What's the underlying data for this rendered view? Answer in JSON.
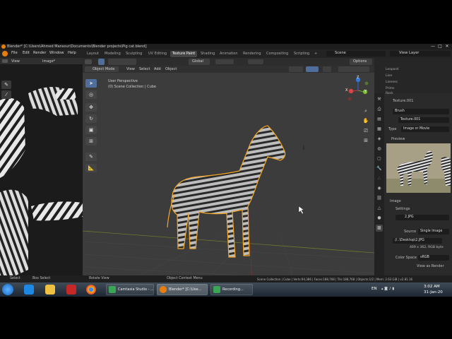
{
  "window": {
    "title": "Blender* [C:\\Users\\Ahmed Mansour\\Documents\\Blender projects\\Pig cat.blend]",
    "min": "—",
    "max": "□",
    "close": "✕"
  },
  "menu": [
    "File",
    "Edit",
    "Render",
    "Window",
    "Help"
  ],
  "workspaces": [
    "Layout",
    "Modeling",
    "Sculpting",
    "UV Editing",
    "Texture Paint",
    "Shading",
    "Animation",
    "Rendering",
    "Compositing",
    "Scripting"
  ],
  "active_workspace": "Texture Paint",
  "scene": {
    "label": "Scene",
    "view_layer": "View Layer"
  },
  "left_editor": {
    "view": "View",
    "image": "Image*"
  },
  "viewport": {
    "mode": "Object Mode",
    "menus": [
      "View",
      "Select",
      "Add",
      "Object"
    ],
    "orientation": "Global",
    "options": "Options",
    "perspective": "User Perspective",
    "collection": "(0) Scene Collection | Cube",
    "gizmo_axes": {
      "x": "X",
      "y": "Y",
      "z": "Z"
    }
  },
  "outliner": [
    "Leopard",
    "Lion",
    "Lioness",
    "Prims",
    "Rock"
  ],
  "properties": {
    "texture_name": "Texture.001",
    "context": "Brush",
    "texture_field": "Texture.001",
    "type_label": "Type",
    "type_value": "Image or Movie",
    "preview_label": "Preview",
    "image_label": "Image",
    "settings_label": "Settings",
    "image_file": "2.JPG",
    "source_label": "Source",
    "source_value": "Single Image",
    "filepath": "//..\\Desktop\\2.JPG",
    "info": "469 x 362,  RGB byte",
    "color_space_label": "Color Space",
    "color_space_value": "sRGB",
    "view_as_render": "View as Render"
  },
  "statusbar": {
    "select": "Select",
    "box_select": "Box Select",
    "rotate_view": "Rotate View",
    "context_menu": "Object Context Menu",
    "stats": "Scene Collection | Cube | Verts:94,386 | Faces:188,768 | Tris:188,768 | Objects:1/2 | Mem: 2.63 GiB | v2.81.16"
  },
  "taskbar": {
    "camtasia": "Camtasia Studio - ...",
    "blender": "Blender* [C:\\Use...",
    "recording": "Recording...",
    "lang": "EN",
    "time": "3:02 AM",
    "date": "31-Jan-20"
  },
  "colors": {
    "accent": "#4f6e9c",
    "outline": "#f5a623",
    "active_tab": "#454545"
  }
}
